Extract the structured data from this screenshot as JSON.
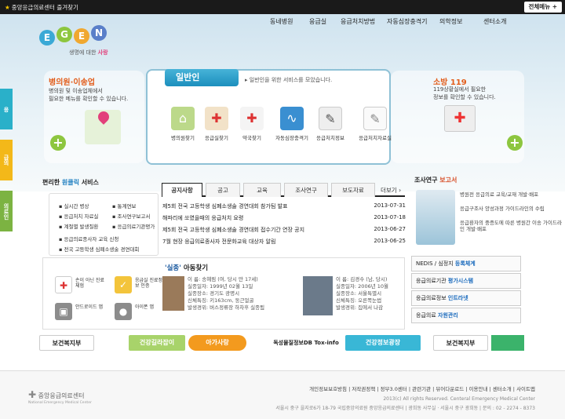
{
  "top_bar": {
    "bookmark": "중앙응급의료센터 즐겨찾기",
    "all_menu": "전체메뉴 +"
  },
  "nav": [
    "동네병원",
    "응급실",
    "응급처치방법",
    "자동심장충격기",
    "의학정보",
    "센터소개"
  ],
  "logo": {
    "tag_normal": "생명에 대한 ",
    "tag_bold": "사랑"
  },
  "side_tabs": [
    "응",
    "급의",
    "의료인"
  ],
  "left_panel": {
    "title": "병의원·이송업",
    "desc": [
      "병의원 및 이송업체에서",
      "필요한 메뉴를 확인할 수 있습니다."
    ]
  },
  "right_panel": {
    "title": "소방 119",
    "desc": [
      "119상황실에서 필요한",
      "정보를 확인할 수 있습니다."
    ]
  },
  "center": {
    "tab": "일반인",
    "subtitle": "일반인을 위한 서비스를 모았습니다.",
    "items": [
      {
        "label": "병의원찾기",
        "icon": "hospital-map-icon"
      },
      {
        "label": "응급실찾기",
        "icon": "first-aid-icon"
      },
      {
        "label": "약국찾기",
        "icon": "pharmacy-icon"
      },
      {
        "label": "자동심장충격기",
        "icon": "heart-monitor-icon"
      },
      {
        "label": "응급처치정보",
        "icon": "first-aid-book-icon"
      },
      {
        "label": "응급처치자료실",
        "icon": "notebook-icon"
      }
    ]
  },
  "quick": {
    "title_normal": "편리한 ",
    "title_bold": "원클릭",
    "title_tail": " 서비스",
    "items": [
      "실시간 병상",
      "통계연보",
      "응급처치 자료실",
      "조사연구보고서",
      "계절별 발생질환",
      "응급의료기관평가",
      "응급의료종사자 교육 신청",
      "전국 고등학생 심폐소생술 경연대회"
    ]
  },
  "news": {
    "tabs": [
      "공지사항",
      "공고",
      "교육",
      "조사연구",
      "보도자료"
    ],
    "more": "더보기",
    "items": [
      {
        "title": "제5회 전국 고등학생 심폐소생술 경연대회 참가팀 발표",
        "date": "2013-07-31"
      },
      {
        "title": "해파리에 쏘였을때의 응급처치 요령",
        "date": "2013-07-18"
      },
      {
        "title": "제5회 전국 고등학생 심폐소생술 경연대회 접수기간 연장 공지",
        "date": "2013-06-27"
      },
      {
        "title": "7월 현장 응급의료종사자 전문화교육 대상자 알림",
        "date": "2013-06-25"
      }
    ]
  },
  "research": {
    "title_a": "조사연구",
    "title_b": "보고서",
    "items": [
      "병원전 응급의료 교육/교재 개발·배포",
      "응급구조사 양성과정 가이드라인의 수립",
      "응급환자의 중증도에 따른 병원간 이송 가이드라인 개발·배포"
    ]
  },
  "missing": {
    "title_a": "'실종'",
    "title_b": " 아동찾기",
    "apps": [
      {
        "label": "손이 아닌 진료 체험",
        "icon": "first-aid-icon"
      },
      {
        "label": "응급실 진료정보 인증",
        "icon": "certificate-icon"
      },
      {
        "label": "안드로이드 앱",
        "icon": "android-icon"
      },
      {
        "label": "아이폰 앱",
        "icon": "apple-icon"
      }
    ],
    "people": [
      [
        "이 름: 송혜림 (여, 당시 만 17세)",
        "실종일자: 1999년 02월 13일",
        "실종장소: 경기도 광명시",
        "신체특징: 키163cm, 둥근얼굴",
        "발생경위: 버스정류장 하차후 실종됨"
      ],
      [
        "이 름: 김경수 (남, 당시)",
        "실종일자: 2006년 10월",
        "실종장소: 서울특별시",
        "신체특징: 오른쪽눈썹",
        "발생경위: 집에서 나감"
      ]
    ]
  },
  "right_buttons": [
    {
      "a": "NEDIS / 심정지 ",
      "b": "등록체계"
    },
    {
      "a": "응급의료기관 ",
      "b": "평가시스템"
    },
    {
      "a": "응급의료정보 ",
      "b": "인트라넷"
    },
    {
      "a": "응급의료 ",
      "b": "자원관리"
    }
  ],
  "banners": [
    "보건복지부",
    "건강길라잡이",
    "아가사랑",
    "독성물질정보DB Tox-info",
    "건강정보광장",
    "보건복지부"
  ],
  "footer": {
    "org": "중앙응급의료센터",
    "org_en": "National Emergency Medical Center",
    "links": "개인정보보호방침 | 저작권정책 | 정부3.0센터 | 관련기관 | 뷰어다운로드 | 이용안내 | 센터소개 | 사이트맵",
    "copy": "2013(c) All rights Reserved. Centeral Emergency Medical Center",
    "address": "서울시 중구 을지로6가 18-79 국립중앙의료원 중앙응급의료센터 | 광희동 사무실 · 서울시 중구 광희동 | 문의 : 02 - 2274 - 8373"
  },
  "colors": {
    "accent": "#1e7fc0",
    "orange": "#e25d1b",
    "green": "#8dc63f"
  }
}
